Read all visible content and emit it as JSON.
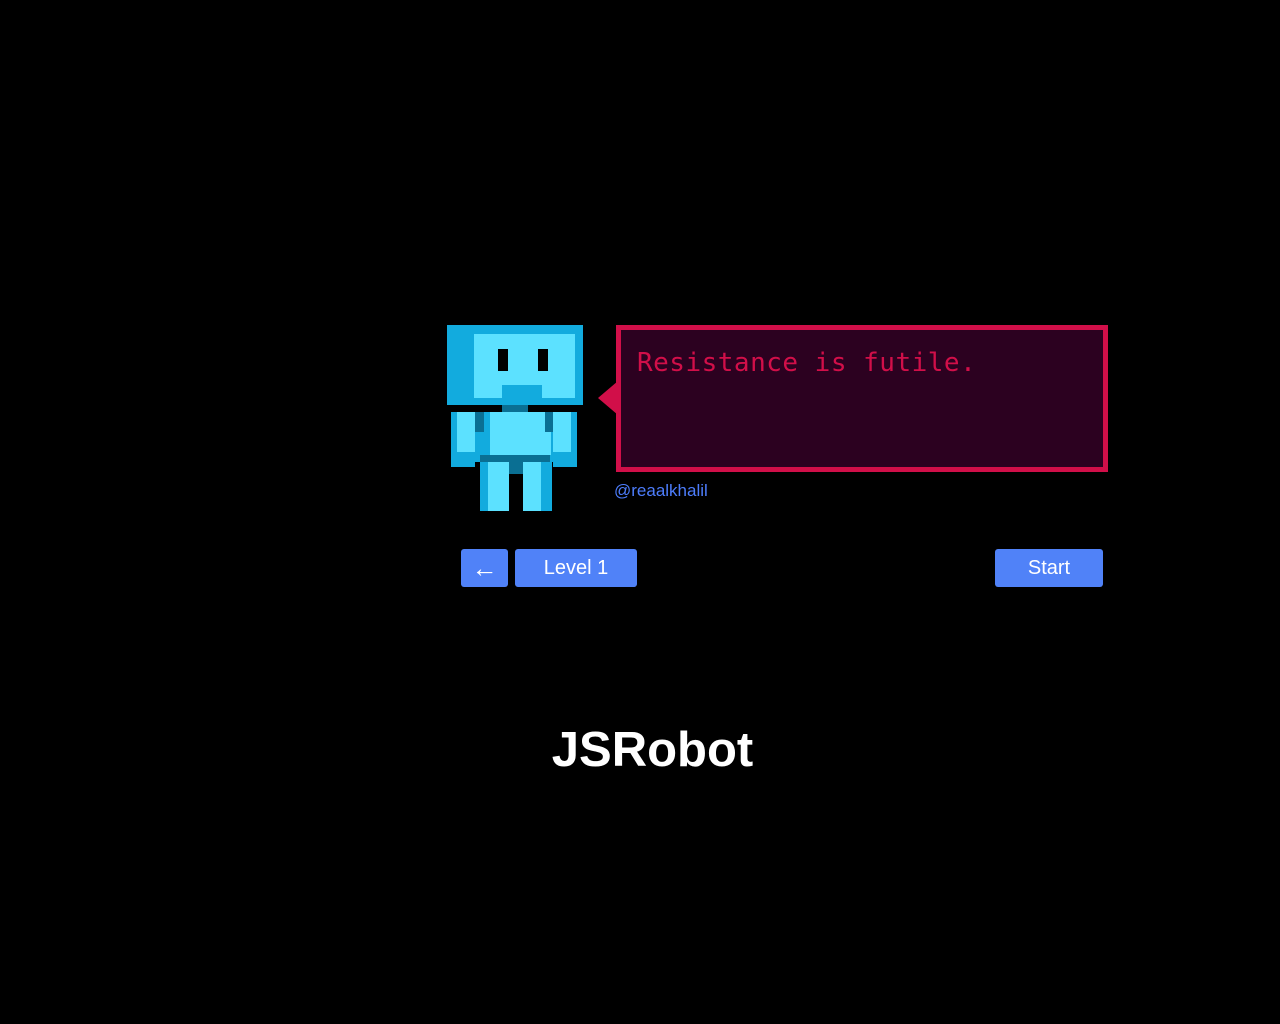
{
  "dialog": {
    "message": "Resistance is futile.",
    "author": "@reaalkhalil"
  },
  "controls": {
    "back_label": "←",
    "level_label": "Level 1",
    "start_label": "Start"
  },
  "game": {
    "title": "JSRobot"
  },
  "colors": {
    "background": "#000000",
    "bubble_border": "#d10f49",
    "bubble_fill": "#2c0120",
    "button": "#5082f8",
    "link": "#4d7dfc",
    "robot_light": "#5ce1ff",
    "robot_mid": "#14b0e3",
    "robot_dark": "#0a6f93"
  },
  "icons": {
    "robot": "robot-icon",
    "back": "left-arrow-icon"
  }
}
